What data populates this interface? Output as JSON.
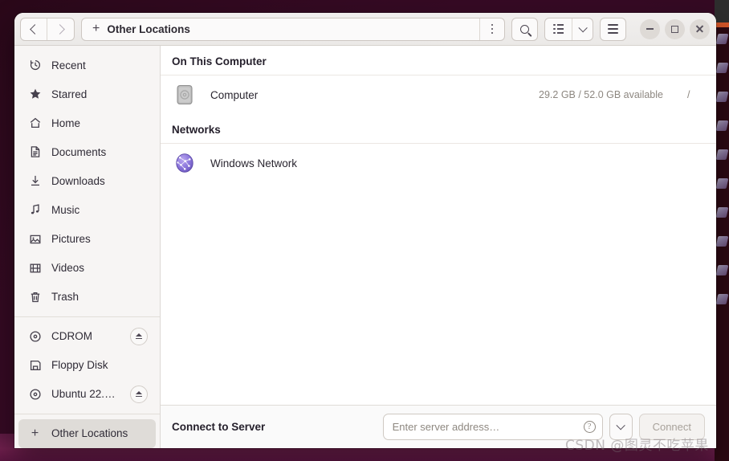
{
  "window": {
    "title": "Other Locations"
  },
  "headerbar": {
    "back_icon": "chevron-left-icon",
    "forward_icon": "chevron-right-icon",
    "path_plus": "+",
    "path_label": "Other Locations",
    "path_menu_icon": "vertical-dots-icon",
    "search_icon": "search-icon",
    "view_list_icon": "list-view-icon",
    "view_dropdown_icon": "chevron-down-icon",
    "menu_icon": "hamburger-menu-icon",
    "minimize_icon": "minimize-icon",
    "maximize_icon": "maximize-icon",
    "close_icon": "close-icon"
  },
  "sidebar": {
    "items": [
      {
        "label": "Recent",
        "icon": "clock-icon",
        "selected": false,
        "eject": false
      },
      {
        "label": "Starred",
        "icon": "star-icon",
        "selected": false,
        "eject": false
      },
      {
        "label": "Home",
        "icon": "home-icon",
        "selected": false,
        "eject": false
      },
      {
        "label": "Documents",
        "icon": "document-icon",
        "selected": false,
        "eject": false
      },
      {
        "label": "Downloads",
        "icon": "download-icon",
        "selected": false,
        "eject": false
      },
      {
        "label": "Music",
        "icon": "music-icon",
        "selected": false,
        "eject": false
      },
      {
        "label": "Pictures",
        "icon": "picture-icon",
        "selected": false,
        "eject": false
      },
      {
        "label": "Videos",
        "icon": "video-icon",
        "selected": false,
        "eject": false
      },
      {
        "label": "Trash",
        "icon": "trash-icon",
        "selected": false,
        "eject": false
      }
    ],
    "devices": [
      {
        "label": "CDROM",
        "icon": "disc-icon",
        "selected": false,
        "eject": true
      },
      {
        "label": "Floppy Disk",
        "icon": "floppy-icon",
        "selected": false,
        "eject": false
      },
      {
        "label": "Ubuntu 22.0…",
        "icon": "disc-icon",
        "selected": false,
        "eject": true
      }
    ],
    "footer_item": {
      "label": "Other Locations",
      "icon": "plus-icon",
      "selected": true,
      "eject": false
    }
  },
  "main": {
    "sections": [
      {
        "title": "On This Computer",
        "rows": [
          {
            "name": "Computer",
            "icon": "harddisk-icon",
            "info": "29.2 GB / 52.0 GB available",
            "mount": "/"
          }
        ]
      },
      {
        "title": "Networks",
        "rows": [
          {
            "name": "Windows Network",
            "icon": "network-globe-icon",
            "info": "",
            "mount": ""
          }
        ]
      }
    ]
  },
  "footer": {
    "label": "Connect to Server",
    "input_value": "",
    "input_placeholder": "Enter server address…",
    "help_icon": "help-icon",
    "dropdown_icon": "chevron-down-icon",
    "connect_label": "Connect"
  },
  "watermark": {
    "text": "CSDN @图灵不吃苹果"
  },
  "colors": {
    "desktop": "#5c1340",
    "window_bg": "#ffffff",
    "sidebar_bg": "#f7f5f4",
    "selection": "#dfdcd8",
    "accent_orange": "#d4572a"
  }
}
